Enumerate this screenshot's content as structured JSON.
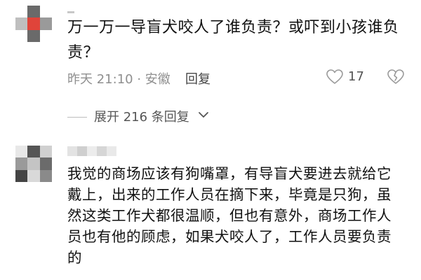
{
  "comment1": {
    "text": "万一万一导盲犬咬人了谁负责？或吓到小孩谁负责？",
    "meta": "昨天 21:10 · 安徽",
    "reply_label": "回复",
    "like_count": "17",
    "avatar_colors": [
      "#ffffff",
      "#6a6a6a",
      "#ffffff",
      "#bfbfbf",
      "#e0443a",
      "#9a9a9a",
      "#ffffff",
      "#6a6a6a",
      "#ffffff"
    ]
  },
  "expand": {
    "text": "展开 216 条回复"
  },
  "comment2": {
    "text": "我觉的商场应该有狗嘴罩，有导盲犬要进去就给它戴上，出来的工作人员在摘下来，毕竟是只狗，虽然这类工作犬都很温顺，但也有意外，商场工作人员也有他的顾虑，如果犬咬人了，工作人员要负责的",
    "avatar_colors": [
      "#e8e8e8",
      "#555555",
      "#d0d0d0",
      "#9a9a9a",
      "#c4c4c4",
      "#6b6b6b",
      "#444444",
      "#d9d9d9",
      "#8a8a8a"
    ],
    "name_colors": [
      "#e3e3e3",
      "#cfcfcf",
      "#ececec",
      "#d6d6d6",
      "#e9e9e9"
    ]
  },
  "colors": {
    "meta_gray": "#8f8f8f",
    "icon_gray": "#b0b0b0"
  }
}
